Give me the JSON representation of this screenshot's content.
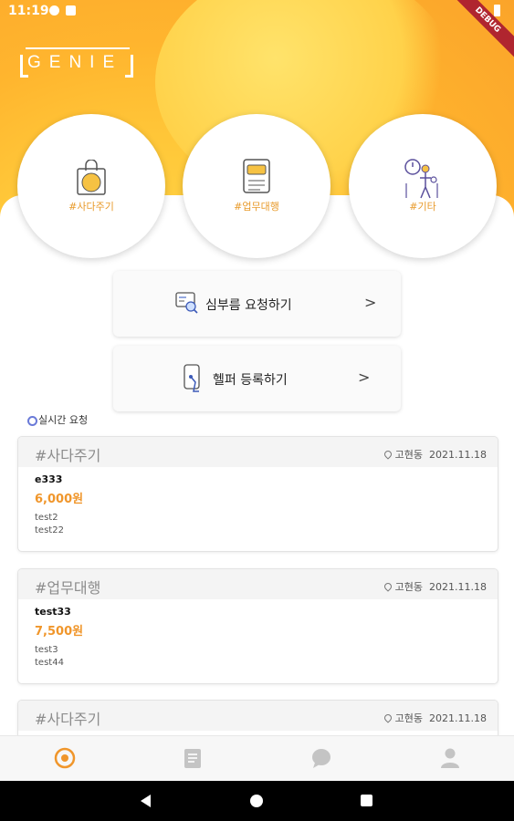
{
  "statusbar": {
    "time": "11:19",
    "debug_label": "DEBUG"
  },
  "logo": "GENIE",
  "categories": [
    {
      "label": "#사다주기",
      "icon": "shopping-bag-icon"
    },
    {
      "label": "#업무대행",
      "icon": "document-icon"
    },
    {
      "label": "#기타",
      "icon": "person-stopwatch-icon"
    }
  ],
  "actions": [
    {
      "label": "심부름 요청하기",
      "icon": "request-errand-icon",
      "chevron": ">"
    },
    {
      "label": "헬퍼 등록하기",
      "icon": "helper-register-icon",
      "chevron": ">"
    }
  ],
  "section_title": "실시간 요청",
  "cards": [
    {
      "tag": "#사다주기",
      "location": "고현동",
      "date": "2021.11.18",
      "name": "e333",
      "price": "6,000원",
      "line1": "test2",
      "line2": "test22"
    },
    {
      "tag": "#업무대행",
      "location": "고현동",
      "date": "2021.11.18",
      "name": "test33",
      "price": "7,500원",
      "line1": "test3",
      "line2": "test44"
    },
    {
      "tag": "#사다주기",
      "location": "고현동",
      "date": "2021.11.18",
      "name": "",
      "price": "",
      "line1": "",
      "line2": ""
    }
  ],
  "bottom_nav": [
    {
      "name": "home-nav",
      "icon": "home-target-icon",
      "active": true
    },
    {
      "name": "list-nav",
      "icon": "checklist-icon",
      "active": false
    },
    {
      "name": "chat-nav",
      "icon": "chat-bubble-icon",
      "active": false
    },
    {
      "name": "profile-nav",
      "icon": "person-icon",
      "active": false
    }
  ],
  "colors": {
    "accent": "#f0962b",
    "hero_yellow": "#ffc93a",
    "hero_orange": "#fba42a"
  }
}
